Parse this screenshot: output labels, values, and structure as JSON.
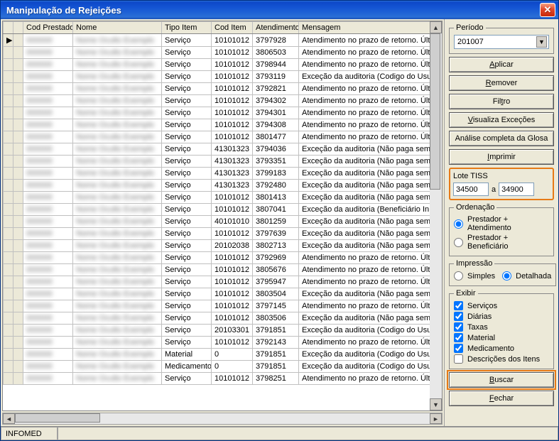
{
  "title": "Manipulação de Rejeições",
  "columns": {
    "cod_prestador": "Cod Prestador",
    "nome": "Nome",
    "tipo_item": "Tipo Item",
    "cod_item": "Cod Item",
    "atendimento": "Atendimento",
    "mensagem": "Mensagem"
  },
  "rows": [
    {
      "tipo": "Serviço",
      "cod": "10101012",
      "atend": "3797928",
      "msg": "Atendimento no prazo de retorno. Últ"
    },
    {
      "tipo": "Serviço",
      "cod": "10101012",
      "atend": "3806503",
      "msg": "Atendimento no prazo de retorno. Últ"
    },
    {
      "tipo": "Serviço",
      "cod": "10101012",
      "atend": "3798944",
      "msg": "Atendimento no prazo de retorno. Últ"
    },
    {
      "tipo": "Serviço",
      "cod": "10101012",
      "atend": "3793119",
      "msg": "Exceção da auditoria (Codigo do Usu"
    },
    {
      "tipo": "Serviço",
      "cod": "10101012",
      "atend": "3792821",
      "msg": "Atendimento no prazo de retorno. Últ"
    },
    {
      "tipo": "Serviço",
      "cod": "10101012",
      "atend": "3794302",
      "msg": "Atendimento no prazo de retorno. Últ"
    },
    {
      "tipo": "Serviço",
      "cod": "10101012",
      "atend": "3794301",
      "msg": "Atendimento no prazo de retorno. Últ"
    },
    {
      "tipo": "Serviço",
      "cod": "10101012",
      "atend": "3794308",
      "msg": "Atendimento no prazo de retorno. Últ"
    },
    {
      "tipo": "Serviço",
      "cod": "10101012",
      "atend": "3801477",
      "msg": "Atendimento no prazo de retorno. Últ"
    },
    {
      "tipo": "Serviço",
      "cod": "41301323",
      "atend": "3794036",
      "msg": "Exceção da auditoria (Não paga sem"
    },
    {
      "tipo": "Serviço",
      "cod": "41301323",
      "atend": "3793351",
      "msg": "Exceção da auditoria (Não paga sem"
    },
    {
      "tipo": "Serviço",
      "cod": "41301323",
      "atend": "3799183",
      "msg": "Exceção da auditoria (Não paga sem"
    },
    {
      "tipo": "Serviço",
      "cod": "41301323",
      "atend": "3792480",
      "msg": "Exceção da auditoria (Não paga sem"
    },
    {
      "tipo": "Serviço",
      "cod": "10101012",
      "atend": "3801413",
      "msg": "Exceção da auditoria (Não paga sem"
    },
    {
      "tipo": "Serviço",
      "cod": "10101012",
      "atend": "3807041",
      "msg": "Exceção da auditoria (Beneficiário In"
    },
    {
      "tipo": "Serviço",
      "cod": "40101010",
      "atend": "3801259",
      "msg": "Exceção da auditoria (Não paga sem"
    },
    {
      "tipo": "Serviço",
      "cod": "10101012",
      "atend": "3797639",
      "msg": "Exceção da auditoria (Não paga sem"
    },
    {
      "tipo": "Serviço",
      "cod": "20102038",
      "atend": "3802713",
      "msg": "Exceção da auditoria (Não paga sem"
    },
    {
      "tipo": "Serviço",
      "cod": "10101012",
      "atend": "3792969",
      "msg": "Atendimento no prazo de retorno. Últ"
    },
    {
      "tipo": "Serviço",
      "cod": "10101012",
      "atend": "3805676",
      "msg": "Atendimento no prazo de retorno. Últ"
    },
    {
      "tipo": "Serviço",
      "cod": "10101012",
      "atend": "3795947",
      "msg": "Atendimento no prazo de retorno. Últ"
    },
    {
      "tipo": "Serviço",
      "cod": "10101012",
      "atend": "3803504",
      "msg": "Exceção da auditoria (Não paga sem"
    },
    {
      "tipo": "Serviço",
      "cod": "10101012",
      "atend": "3797145",
      "msg": "Atendimento no prazo de retorno. Últ"
    },
    {
      "tipo": "Serviço",
      "cod": "10101012",
      "atend": "3803506",
      "msg": "Exceção da auditoria (Não paga sem"
    },
    {
      "tipo": "Serviço",
      "cod": "20103301",
      "atend": "3791851",
      "msg": "Exceção da auditoria (Codigo do Usu"
    },
    {
      "tipo": "Serviço",
      "cod": "10101012",
      "atend": "3792143",
      "msg": "Atendimento no prazo de retorno. Últ"
    },
    {
      "tipo": "Material",
      "cod": "0",
      "atend": "3791851",
      "msg": "Exceção da auditoria (Codigo do Usu"
    },
    {
      "tipo": "Medicamento",
      "cod": "0",
      "atend": "3791851",
      "msg": "Exceção da auditoria (Codigo do Usu"
    },
    {
      "tipo": "Serviço",
      "cod": "10101012",
      "atend": "3798251",
      "msg": "Atendimento no prazo de retorno. Últ"
    }
  ],
  "side": {
    "periodo_legend": "Período",
    "periodo_value": "201007",
    "aplicar": "Aplicar",
    "remover": "Remover",
    "filtro": "Filtro",
    "visualiza": "Visualiza Exceções",
    "analise": "Análise completa da Glosa",
    "imprimir": "Imprimir",
    "lote_legend": "Lote TISS",
    "lote_from": "34500",
    "lote_sep": "a",
    "lote_to": "34900",
    "ordenacao_legend": "Ordenação",
    "ord_opt1": "Prestador + Atendimento",
    "ord_opt2": "Prestador + Beneficiário",
    "impressao_legend": "Impressão",
    "imp_simples": "Simples",
    "imp_detalhada": "Detalhada",
    "exibir_legend": "Exibir",
    "ex_servicos": "Serviços",
    "ex_diarias": "Diárias",
    "ex_taxas": "Taxas",
    "ex_material": "Material",
    "ex_medicamento": "Medicamento",
    "ex_descricoes": "Descrições dos Itens",
    "buscar": "Buscar",
    "fechar": "Fechar"
  },
  "status": "INFOMED"
}
